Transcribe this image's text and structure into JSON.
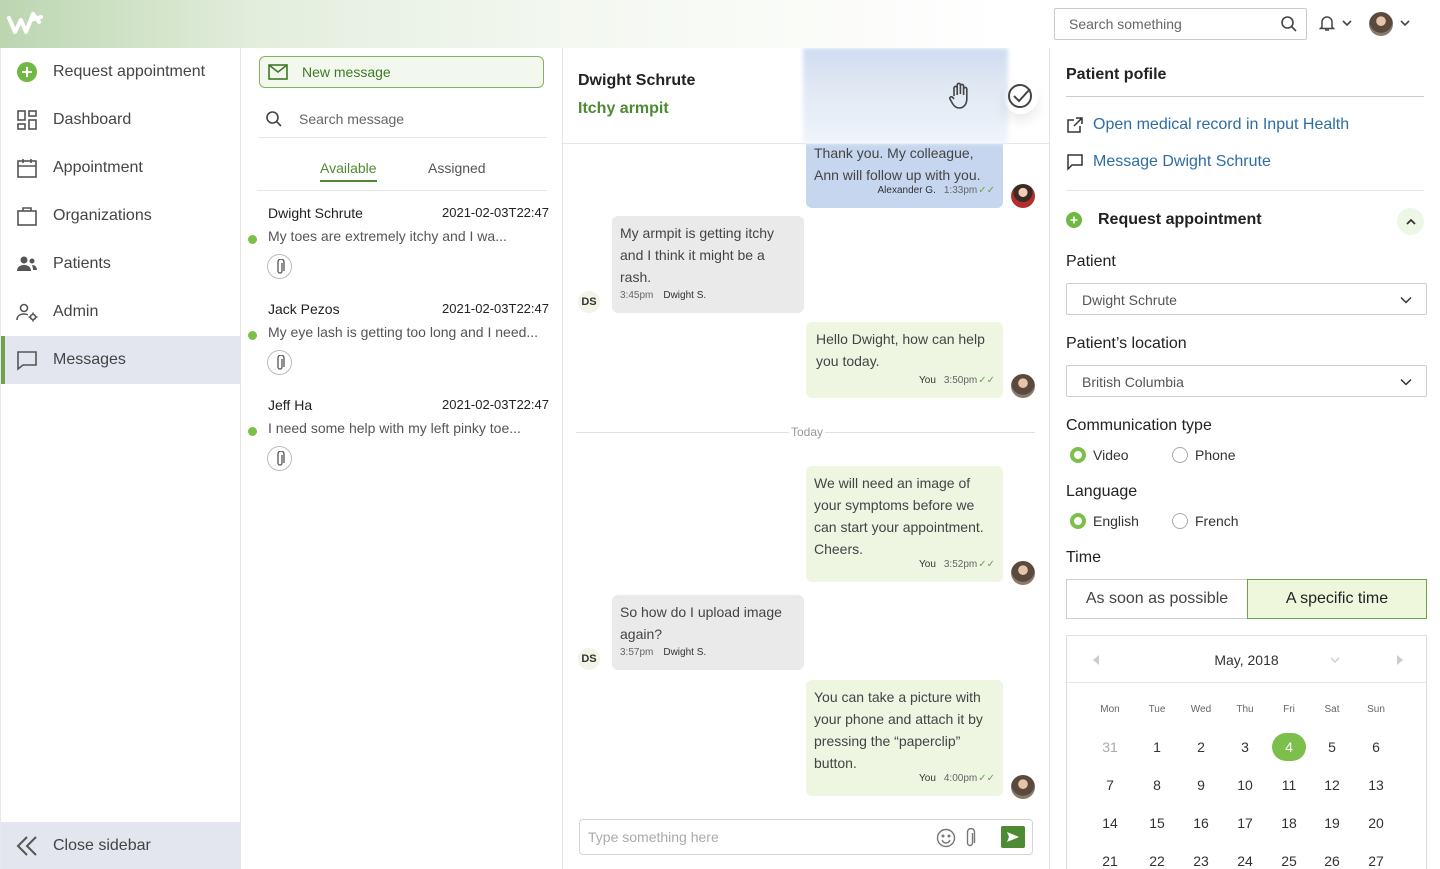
{
  "topbar": {
    "search_placeholder": "Search something"
  },
  "sidebar": {
    "items": [
      {
        "label": "Request appointment",
        "icon": "plus-circle-icon"
      },
      {
        "label": "Dashboard",
        "icon": "dashboard-icon"
      },
      {
        "label": "Appointment",
        "icon": "calendar-icon"
      },
      {
        "label": "Organizations",
        "icon": "briefcase-icon"
      },
      {
        "label": "Patients",
        "icon": "people-icon"
      },
      {
        "label": "Admin",
        "icon": "admin-icon"
      },
      {
        "label": "Messages",
        "icon": "chat-icon"
      }
    ],
    "close_label": "Close sidebar"
  },
  "messages": {
    "new_label": "New message",
    "search_placeholder": "Search message",
    "tabs": [
      "Available",
      "Assigned"
    ],
    "conversations": [
      {
        "name": "Dwight Schrute",
        "date": "2021-02-03T22:47",
        "preview": "My toes are extremely itchy and I wa..."
      },
      {
        "name": "Jack Pezos",
        "date": "2021-02-03T22:47",
        "preview": "My eye lash is getting too long and I need..."
      },
      {
        "name": "Jeff Ha",
        "date": "2021-02-03T22:47",
        "preview": "I need some help with my left pinky toe..."
      }
    ]
  },
  "chat": {
    "name": "Dwight Schrute",
    "subject": "Itchy armpit",
    "messages": [
      {
        "text": "Thank you. My colleague, Ann will follow up with you.",
        "sender": "Alexander G.",
        "time": "1:33pm",
        "ticks": "✓✓"
      },
      {
        "text": "My armpit is getting itchy and I think it might be a rash.",
        "sender": "Dwight S.",
        "time": "3:45pm",
        "initials": "DS"
      },
      {
        "text": "Hello Dwight, how can help you today.",
        "sender": "You",
        "time": "3:50pm",
        "ticks": "✓✓"
      },
      {
        "text": "We will need an image of your symptoms before we can start your appointment. Cheers.",
        "sender": "You",
        "time": "3:52pm",
        "ticks": "✓✓"
      },
      {
        "text": "So how do I upload image again?",
        "sender": "Dwight S.",
        "time": "3:57pm",
        "initials": "DS"
      },
      {
        "text": "You can take a picture with your phone and attach it by pressing the “paperclip” button.",
        "sender": "You",
        "time": "4:00pm",
        "ticks": "✓✓"
      }
    ],
    "divider": "Today",
    "composer_placeholder": "Type something here"
  },
  "profile": {
    "title": "Patient pofile",
    "link_record": "Open medical record in Input Health",
    "link_message": "Message Dwight Schrute",
    "request_title": "Request appointment",
    "patient_label": "Patient",
    "patient_value": "Dwight Schrute",
    "location_label": "Patient’s location",
    "location_value": "British Columbia",
    "comm_label": "Communication type",
    "comm_options": [
      "Video",
      "Phone"
    ],
    "lang_label": "Language",
    "lang_options": [
      "English",
      "French"
    ],
    "time_label": "Time",
    "time_options": [
      "As soon as possible",
      "A specific time"
    ],
    "calendar": {
      "month": "May, 2018",
      "dow": [
        "Mon",
        "Tue",
        "Wed",
        "Thu",
        "Fri",
        "Sat",
        "Sun"
      ],
      "weeks": [
        [
          "31",
          "1",
          "2",
          "3",
          "4",
          "5",
          "6"
        ],
        [
          "7",
          "8",
          "9",
          "10",
          "11",
          "12",
          "13"
        ],
        [
          "14",
          "15",
          "16",
          "17",
          "18",
          "19",
          "20"
        ],
        [
          "21",
          "22",
          "23",
          "24",
          "25",
          "26",
          "27"
        ]
      ],
      "selected": "4"
    }
  },
  "colors": {
    "accent_green": "#7cc04b",
    "dark_green": "#4e8a33",
    "link_blue": "#2d6da3",
    "active_nav_bg": "#e3e6ee"
  }
}
